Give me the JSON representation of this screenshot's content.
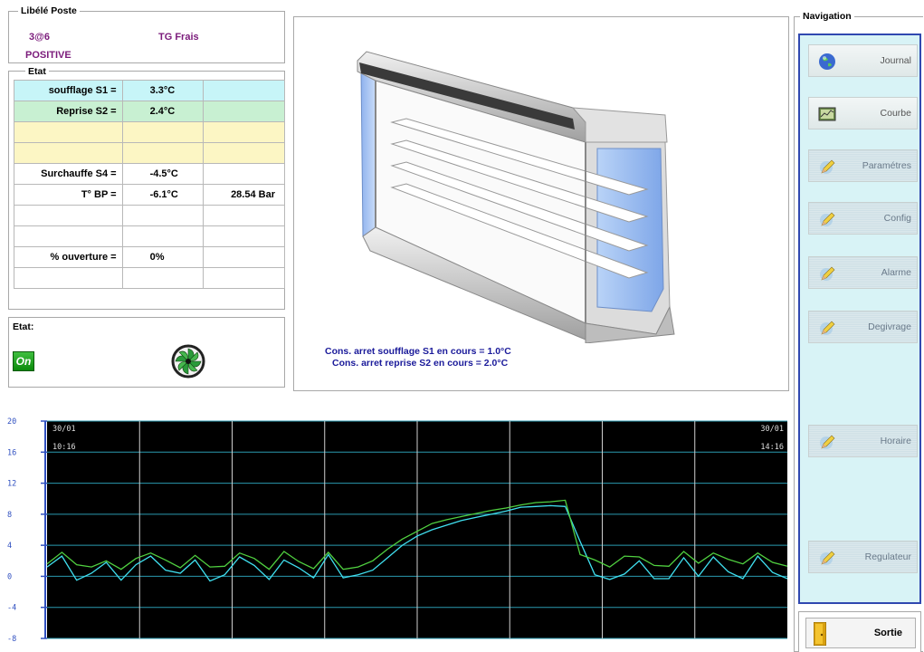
{
  "poste": {
    "legend": "Libélé Poste",
    "code": "3@6",
    "name": "TG Frais",
    "type": "POSITIVE"
  },
  "etat": {
    "legend": "Etat",
    "rows": [
      {
        "label": "soufflage  S1 =",
        "value": "3.3°C",
        "extra": "",
        "style": "cyan"
      },
      {
        "label": "Reprise  S2 =",
        "value": "2.4°C",
        "extra": "",
        "style": "green"
      },
      {
        "label": "",
        "value": "",
        "extra": "",
        "style": "yellow"
      },
      {
        "label": "",
        "value": "",
        "extra": "",
        "style": "yellow"
      },
      {
        "label": "Surchauffe  S4 =",
        "value": "-4.5°C",
        "extra": "",
        "style": ""
      },
      {
        "label": "T° BP =",
        "value": "-6.1°C",
        "extra": "28.54 Bar",
        "style": ""
      },
      {
        "label": "",
        "value": "",
        "extra": "",
        "style": ""
      },
      {
        "label": "",
        "value": "",
        "extra": "",
        "style": ""
      },
      {
        "label": "% ouverture =",
        "value": "0%",
        "extra": "",
        "style": ""
      },
      {
        "label": "",
        "value": "",
        "extra": "",
        "style": ""
      }
    ]
  },
  "status": {
    "title": "Etat:",
    "on_label": "On",
    "icons": [
      "on-icon",
      "fan-icon"
    ]
  },
  "consignes": {
    "line1_label": "Cons. arret soufflage S1 en cours =",
    "line1_value": "1.0°C",
    "line2_label": "Cons. arret reprise S2 en cours =",
    "line2_value": "2.0°C"
  },
  "navigation": {
    "legend": "Navigation",
    "buttons": [
      {
        "label": "Journal",
        "icon": "globe-icon",
        "enabled": true
      },
      {
        "label": "Courbe",
        "icon": "chart-icon",
        "enabled": true
      },
      {
        "label": "Paramétres",
        "icon": "pencil-icon",
        "enabled": false
      },
      {
        "label": "Config",
        "icon": "pencil-icon",
        "enabled": false
      },
      {
        "label": "Alarme",
        "icon": "pencil-icon",
        "enabled": false
      },
      {
        "label": "Degivrage",
        "icon": "pencil-icon",
        "enabled": false
      },
      {
        "label": "Horaire",
        "icon": "pencil-icon",
        "enabled": false
      },
      {
        "label": "Regulateur",
        "icon": "pencil-icon",
        "enabled": false
      }
    ],
    "exit_label": "Sortie"
  },
  "colors": {
    "nav_border": "#3048b0",
    "nav_bg": "#d8f3f6",
    "title_purple": "#7a1a7a",
    "cons_blue": "#1a1a9a",
    "chart_bg": "#000000",
    "grid": "#2a9ab0",
    "series_s1": "#40e0f0",
    "series_s2": "#50d040"
  },
  "chart_data": {
    "type": "line",
    "start_label": [
      "30/01",
      "10:16"
    ],
    "end_label": [
      "30/01",
      "14:16"
    ],
    "ylim": [
      -8,
      20
    ],
    "yticks": [
      20,
      16,
      12,
      8,
      4,
      0,
      -4,
      -8
    ],
    "xlabel": "",
    "ylabel": "",
    "grid": true,
    "x": [
      0,
      2,
      4,
      6,
      8,
      10,
      12,
      14,
      16,
      18,
      20,
      22,
      24,
      26,
      28,
      30,
      32,
      34,
      36,
      38,
      40,
      42,
      44,
      46,
      48,
      50,
      52,
      54,
      56,
      58,
      60,
      62,
      64,
      66,
      68,
      70,
      72,
      74,
      76,
      78,
      80,
      82,
      84,
      86,
      88,
      90,
      92,
      94,
      96,
      98,
      100
    ],
    "series": [
      {
        "values": [
          1.2,
          2.6,
          -0.5,
          0.4,
          1.8,
          -0.5,
          1.5,
          2.6,
          0.8,
          0.4,
          2.1,
          -0.6,
          0.2,
          2.5,
          1.4,
          -0.4,
          2.1,
          1.1,
          -0.2,
          2.8,
          -0.2,
          0.2,
          0.8,
          2.4,
          4.0,
          5.2,
          6.0,
          6.6,
          7.2,
          7.6,
          8.0,
          8.4,
          8.9,
          9.0,
          9.1,
          9.0,
          4.5,
          0.2,
          -0.4,
          0.3,
          2.0,
          -0.3,
          -0.3,
          2.4,
          0.0,
          2.5,
          0.6,
          -0.3,
          2.6,
          0.5,
          -0.3
        ]
      },
      {
        "values": [
          1.6,
          3.1,
          1.5,
          1.2,
          2.0,
          0.9,
          2.3,
          3.0,
          2.1,
          1.1,
          2.7,
          1.2,
          1.3,
          3.0,
          2.3,
          0.9,
          3.2,
          1.9,
          1.0,
          3.1,
          0.9,
          1.2,
          2.0,
          3.5,
          4.8,
          5.8,
          6.8,
          7.3,
          7.7,
          8.1,
          8.5,
          8.8,
          9.2,
          9.5,
          9.6,
          9.8,
          2.8,
          2.1,
          1.2,
          2.6,
          2.5,
          1.4,
          1.3,
          3.2,
          1.7,
          3.0,
          2.2,
          1.6,
          3.0,
          1.8,
          1.3
        ]
      }
    ]
  }
}
